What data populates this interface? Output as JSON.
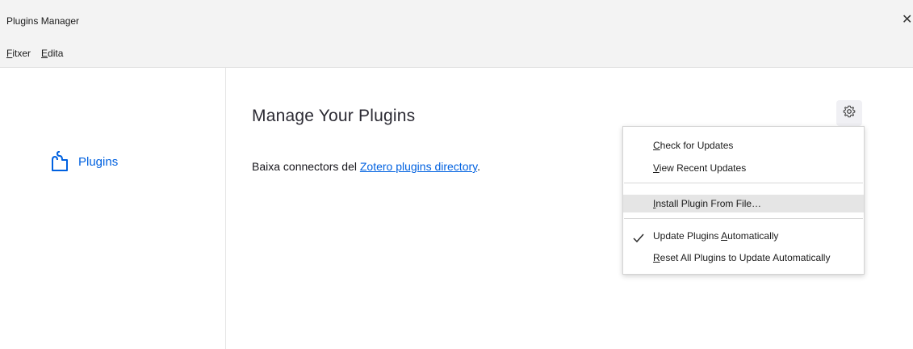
{
  "window": {
    "title": "Plugins Manager",
    "close_glyph": "✕"
  },
  "menubar": {
    "file_acc": "F",
    "file_rest": "itxer",
    "edit_acc": "E",
    "edit_rest": "dita"
  },
  "sidebar": {
    "categories": [
      {
        "label": "Plugins",
        "icon": "plugin-puzzle-icon",
        "selected": true
      }
    ]
  },
  "main": {
    "heading": "Manage Your Plugins",
    "intro_prefix": "Baixa connectors del ",
    "intro_link": "Zotero plugins directory",
    "intro_suffix": "."
  },
  "tools_menu": {
    "check_updates_acc": "C",
    "check_updates_rest": "heck for Updates",
    "view_recent_acc": "V",
    "view_recent_rest": "iew Recent Updates",
    "install_acc": "I",
    "install_rest": "nstall Plugin From File…",
    "auto_update_pre": "Update Plugins ",
    "auto_update_acc": "A",
    "auto_update_post": "utomatically",
    "auto_update_checked": true,
    "reset_acc": "R",
    "reset_rest": "eset All Plugins to Update Automatically"
  },
  "colors": {
    "accent": "#0061e0",
    "chrome_bg": "#f3f3f3",
    "menu_hover": "#e5e5e5"
  }
}
